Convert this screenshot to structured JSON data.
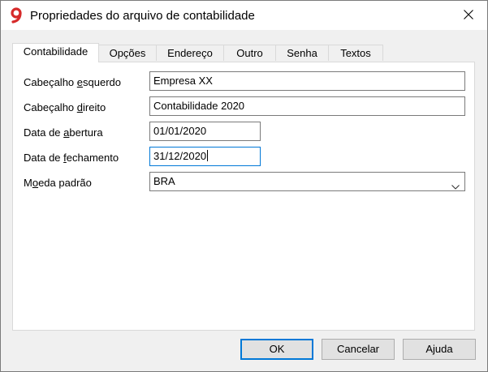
{
  "window": {
    "title": "Propriedades do arquivo de contabilidade",
    "app_icon": "banana-9-logo-icon",
    "close_icon": "close-icon"
  },
  "tabs": [
    {
      "label": "Contabilidade",
      "active": true
    },
    {
      "label": "Opções",
      "active": false
    },
    {
      "label": "Endereço",
      "active": false
    },
    {
      "label": "Outro",
      "active": false
    },
    {
      "label": "Senha",
      "active": false
    },
    {
      "label": "Textos",
      "active": false
    }
  ],
  "form": {
    "left_header": {
      "label_pre": "Cabeçalho ",
      "label_ul": "e",
      "label_post": "squerdo",
      "value": "Empresa XX"
    },
    "right_header": {
      "label_pre": "Cabeçalho ",
      "label_ul": "d",
      "label_post": "ireito",
      "value": "Contabilidade 2020"
    },
    "opening_date": {
      "label_pre": "Data de ",
      "label_ul": "a",
      "label_post": "bertura",
      "value": "01/01/2020"
    },
    "closing_date": {
      "label_pre": "Data de ",
      "label_ul": "f",
      "label_post": "echamento",
      "value": "31/12/2020"
    },
    "currency": {
      "label_pre": "M",
      "label_ul": "o",
      "label_post": "eda padrão",
      "value": "BRA"
    }
  },
  "buttons": {
    "ok": "OK",
    "cancel": "Cancelar",
    "help": "Ajuda"
  },
  "colors": {
    "accent": "#0078d7",
    "logo_red": "#d62a2a"
  }
}
